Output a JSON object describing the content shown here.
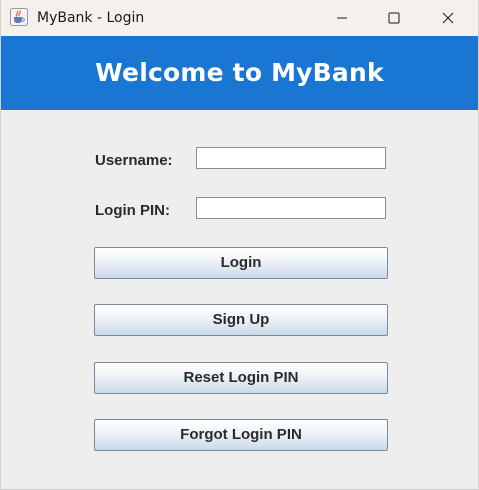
{
  "window": {
    "title": "MyBank - Login",
    "app_icon": "java-cup-icon"
  },
  "header": {
    "title": "Welcome to MyBank",
    "background": "#1976d2"
  },
  "form": {
    "username_label": "Username:",
    "username_value": "",
    "pin_label": "Login PIN:",
    "pin_value": ""
  },
  "buttons": {
    "login": "Login",
    "sign_up": "Sign Up",
    "reset_pin": "Reset Login PIN",
    "forgot_pin": "Forgot Login PIN"
  }
}
